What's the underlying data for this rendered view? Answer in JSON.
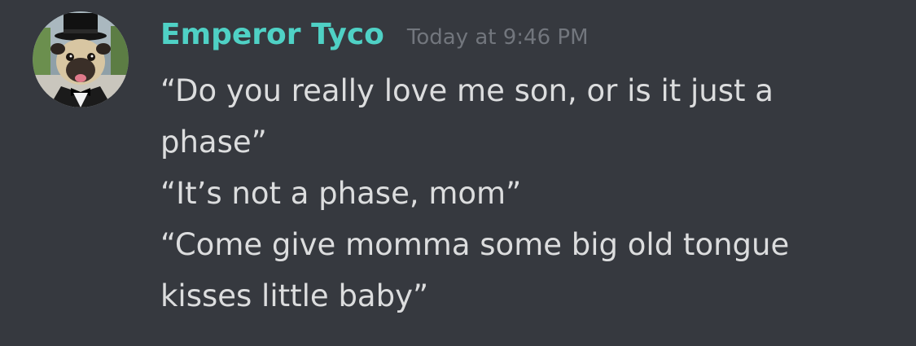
{
  "message": {
    "author": "Emperor Tyco",
    "timestamp": "Today at 9:46 PM",
    "author_color": "#4fd1c5",
    "avatar_icon": "pug-in-top-hat-avatar",
    "lines": [
      "“Do you really love me son, or is it just a phase”",
      "“It’s not a phase, mom”",
      "“Come give momma some big old tongue kisses little baby”"
    ]
  },
  "colors": {
    "background": "#36393f",
    "text": "#dcddde",
    "timestamp": "#72767d"
  }
}
